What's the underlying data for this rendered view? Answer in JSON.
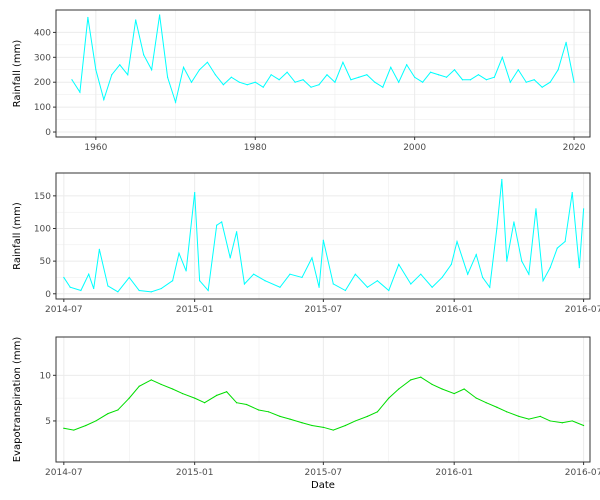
{
  "colors": {
    "rainfall": "#00ffff",
    "evapotranspiration": "#00dd00",
    "grid": "#ebebeb",
    "panel_border": "#333333"
  },
  "chart_data": [
    {
      "type": "line",
      "ylabel": "Rainfall (mm)",
      "xlabel": "",
      "grid": true,
      "xlim": [
        1955,
        2022
      ],
      "ylim": [
        -20,
        490
      ],
      "x_ticks": [
        1960,
        1980,
        2000,
        2020
      ],
      "x_tick_labels": [
        "1960",
        "1980",
        "2000",
        "2020"
      ],
      "y_ticks": [
        0,
        100,
        200,
        300,
        400
      ],
      "series": [
        {
          "x": [
            1957,
            1958,
            1959,
            1960,
            1961,
            1962,
            1963,
            1964,
            1965,
            1966,
            1967,
            1968,
            1969,
            1970,
            1971,
            1972,
            1973,
            1974,
            1975,
            1976,
            1977,
            1978,
            1979,
            1980,
            1981,
            1982,
            1983,
            1984,
            1985,
            1986,
            1987,
            1988,
            1989,
            1990,
            1991,
            1992,
            1993,
            1994,
            1995,
            1996,
            1997,
            1998,
            1999,
            2000,
            2001,
            2002,
            2003,
            2004,
            2005,
            2006,
            2007,
            2008,
            2009,
            2010,
            2011,
            2012,
            2013,
            2014,
            2015,
            2016,
            2017,
            2018,
            2019,
            2020
          ],
          "values": [
            210,
            160,
            460,
            250,
            130,
            230,
            270,
            230,
            450,
            310,
            250,
            470,
            220,
            120,
            260,
            200,
            250,
            280,
            230,
            190,
            220,
            200,
            190,
            200,
            180,
            230,
            210,
            240,
            200,
            210,
            180,
            190,
            230,
            200,
            280,
            210,
            220,
            230,
            200,
            180,
            260,
            200,
            270,
            220,
            200,
            240,
            230,
            220,
            250,
            210,
            210,
            230,
            210,
            220,
            300,
            200,
            250,
            200,
            210,
            180,
            200,
            250,
            360,
            200
          ]
        }
      ]
    },
    {
      "type": "line",
      "ylabel": "Rainfall (mm)",
      "xlabel": "",
      "grid": true,
      "xlim": [
        "2014-06-20",
        "2016-07-10"
      ],
      "ylim": [
        -8,
        185
      ],
      "x_ticks": [
        "2014-07-01",
        "2015-01-01",
        "2015-07-01",
        "2016-01-01",
        "2016-07-01"
      ],
      "x_tick_labels": [
        "2014-07",
        "2015-01",
        "2015-07",
        "2016-01",
        "2016-07"
      ],
      "y_ticks": [
        0,
        50,
        100,
        150
      ],
      "series": [
        {
          "x": [
            "2014-07-01",
            "2014-07-10",
            "2014-07-25",
            "2014-08-05",
            "2014-08-12",
            "2014-08-20",
            "2014-09-01",
            "2014-09-15",
            "2014-10-01",
            "2014-10-15",
            "2014-11-01",
            "2014-11-15",
            "2014-12-01",
            "2014-12-10",
            "2014-12-20",
            "2015-01-01",
            "2015-01-08",
            "2015-01-20",
            "2015-02-01",
            "2015-02-08",
            "2015-02-20",
            "2015-03-01",
            "2015-03-12",
            "2015-03-25",
            "2015-04-10",
            "2015-05-01",
            "2015-05-15",
            "2015-06-01",
            "2015-06-15",
            "2015-06-25",
            "2015-07-01",
            "2015-07-15",
            "2015-08-01",
            "2015-08-15",
            "2015-09-01",
            "2015-09-15",
            "2015-10-01",
            "2015-10-15",
            "2015-11-01",
            "2015-11-15",
            "2015-12-01",
            "2015-12-15",
            "2015-12-28",
            "2016-01-05",
            "2016-01-20",
            "2016-02-01",
            "2016-02-10",
            "2016-02-20",
            "2016-03-01",
            "2016-03-08",
            "2016-03-15",
            "2016-03-25",
            "2016-04-05",
            "2016-04-15",
            "2016-04-25",
            "2016-05-05",
            "2016-05-15",
            "2016-05-25",
            "2016-06-05",
            "2016-06-15",
            "2016-06-25",
            "2016-07-01"
          ],
          "values": [
            25,
            10,
            5,
            30,
            8,
            68,
            12,
            3,
            25,
            5,
            3,
            8,
            20,
            62,
            35,
            155,
            20,
            5,
            105,
            110,
            55,
            95,
            15,
            30,
            20,
            10,
            30,
            25,
            55,
            10,
            82,
            15,
            5,
            30,
            10,
            20,
            5,
            45,
            15,
            30,
            10,
            25,
            45,
            80,
            30,
            60,
            25,
            10,
            100,
            175,
            50,
            110,
            50,
            30,
            130,
            20,
            40,
            70,
            80,
            155,
            40,
            130
          ]
        }
      ]
    },
    {
      "type": "line",
      "ylabel": "Evapotranspiration (mm)",
      "xlabel": "Date",
      "grid": true,
      "xlim": [
        "2014-06-20",
        "2016-07-10"
      ],
      "ylim": [
        0.5,
        14.2
      ],
      "x_ticks": [
        "2014-07-01",
        "2015-01-01",
        "2015-07-01",
        "2016-01-01",
        "2016-07-01"
      ],
      "x_tick_labels": [
        "2014-07",
        "2015-01",
        "2015-07",
        "2016-01",
        "2016-07"
      ],
      "y_ticks": [
        5,
        10
      ],
      "series": [
        {
          "x": [
            "2014-07-01",
            "2014-07-15",
            "2014-08-01",
            "2014-08-15",
            "2014-09-01",
            "2014-09-15",
            "2014-10-01",
            "2014-10-15",
            "2014-11-01",
            "2014-11-15",
            "2014-12-01",
            "2014-12-15",
            "2015-01-01",
            "2015-01-15",
            "2015-02-01",
            "2015-02-15",
            "2015-03-01",
            "2015-03-15",
            "2015-04-01",
            "2015-04-15",
            "2015-05-01",
            "2015-05-15",
            "2015-06-01",
            "2015-06-15",
            "2015-07-01",
            "2015-07-15",
            "2015-08-01",
            "2015-08-15",
            "2015-09-01",
            "2015-09-15",
            "2015-10-01",
            "2015-10-15",
            "2015-11-01",
            "2015-11-15",
            "2015-12-01",
            "2015-12-15",
            "2016-01-01",
            "2016-01-15",
            "2016-02-01",
            "2016-02-15",
            "2016-03-01",
            "2016-03-15",
            "2016-04-01",
            "2016-04-15",
            "2016-05-01",
            "2016-05-15",
            "2016-06-01",
            "2016-06-15",
            "2016-07-01"
          ],
          "values": [
            4.2,
            4.0,
            4.5,
            5.0,
            5.8,
            6.2,
            7.5,
            8.8,
            9.5,
            9.0,
            8.5,
            8.0,
            7.5,
            7.0,
            7.8,
            8.2,
            7.0,
            6.8,
            6.2,
            6.0,
            5.5,
            5.2,
            4.8,
            4.5,
            4.3,
            4.0,
            4.5,
            5.0,
            5.5,
            6.0,
            7.5,
            8.5,
            9.5,
            9.8,
            9.0,
            8.5,
            8.0,
            8.5,
            7.5,
            7.0,
            6.5,
            6.0,
            5.5,
            5.2,
            5.5,
            5.0,
            4.8,
            5.0,
            4.5
          ]
        }
      ]
    }
  ]
}
